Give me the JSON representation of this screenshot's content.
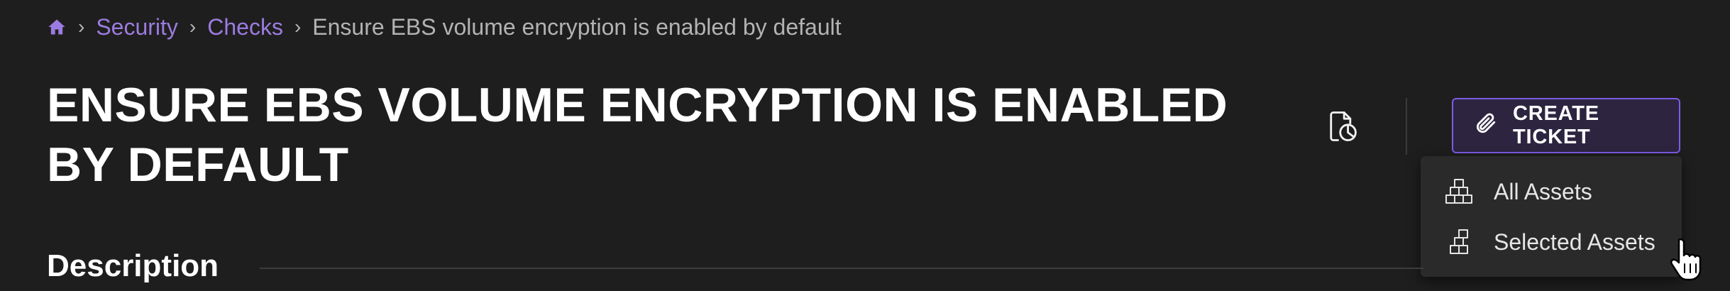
{
  "breadcrumb": {
    "home_icon": "home-icon",
    "items": [
      {
        "label": "Security"
      },
      {
        "label": "Checks"
      }
    ],
    "separator": "›",
    "current": "Ensure EBS volume encryption is enabled by default"
  },
  "page": {
    "title": "ENSURE EBS VOLUME ENCRYPTION IS ENABLED BY DEFAULT"
  },
  "toolbar": {
    "report_icon": "report-document-icon",
    "create_ticket_label": "CREATE TICKET",
    "create_ticket_icon": "paperclip-icon"
  },
  "ticket_menu": {
    "items": [
      {
        "label": "All Assets",
        "icon": "stacked-boxes-icon"
      },
      {
        "label": "Selected Assets",
        "icon": "selected-boxes-icon"
      }
    ]
  },
  "section": {
    "description_heading": "Description"
  },
  "colors": {
    "background": "#1f1e1e",
    "link": "#9b7ce0",
    "accent": "#7c5ce6",
    "button_bg": "#2d2540",
    "menu_bg": "#2a2a2a"
  }
}
